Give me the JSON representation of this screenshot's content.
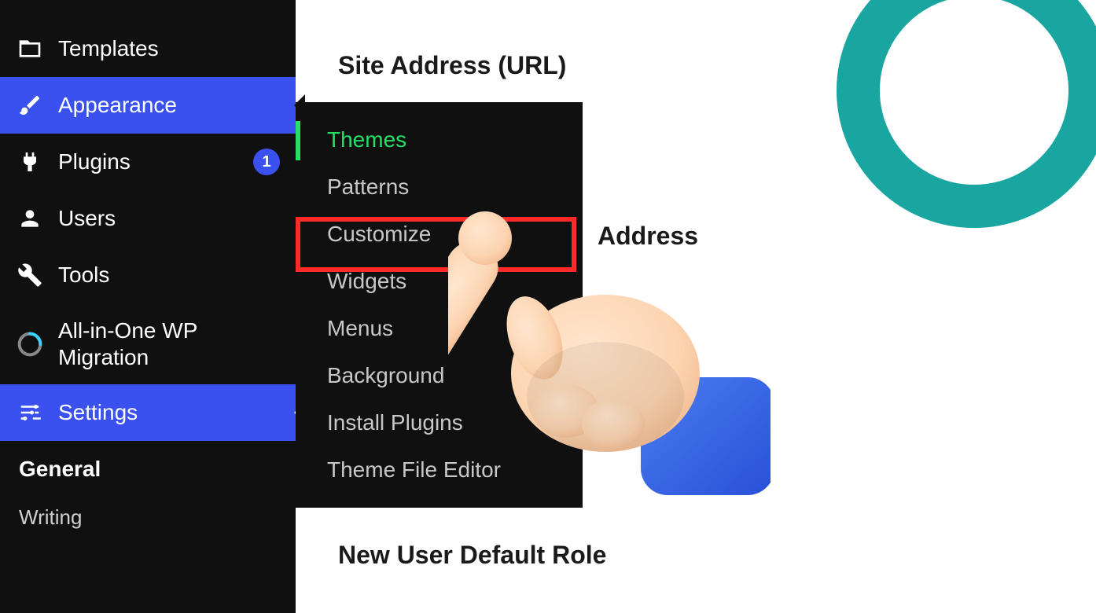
{
  "sidebar": {
    "items": [
      {
        "label": "Templates"
      },
      {
        "label": "Appearance"
      },
      {
        "label": "Plugins",
        "badge": "1"
      },
      {
        "label": "Users"
      },
      {
        "label": "Tools"
      },
      {
        "label": "All-in-One WP Migration"
      },
      {
        "label": "Settings"
      }
    ],
    "sub_general": "General",
    "sub_writing": "Writing"
  },
  "submenu": {
    "items": [
      "Themes",
      "Patterns",
      "Customize",
      "Widgets",
      "Menus",
      "Background",
      "Install Plugins",
      "Theme File Editor"
    ]
  },
  "content": {
    "label1": "Site Address (URL)",
    "label2": "Address",
    "label3": "New User Default Role"
  }
}
